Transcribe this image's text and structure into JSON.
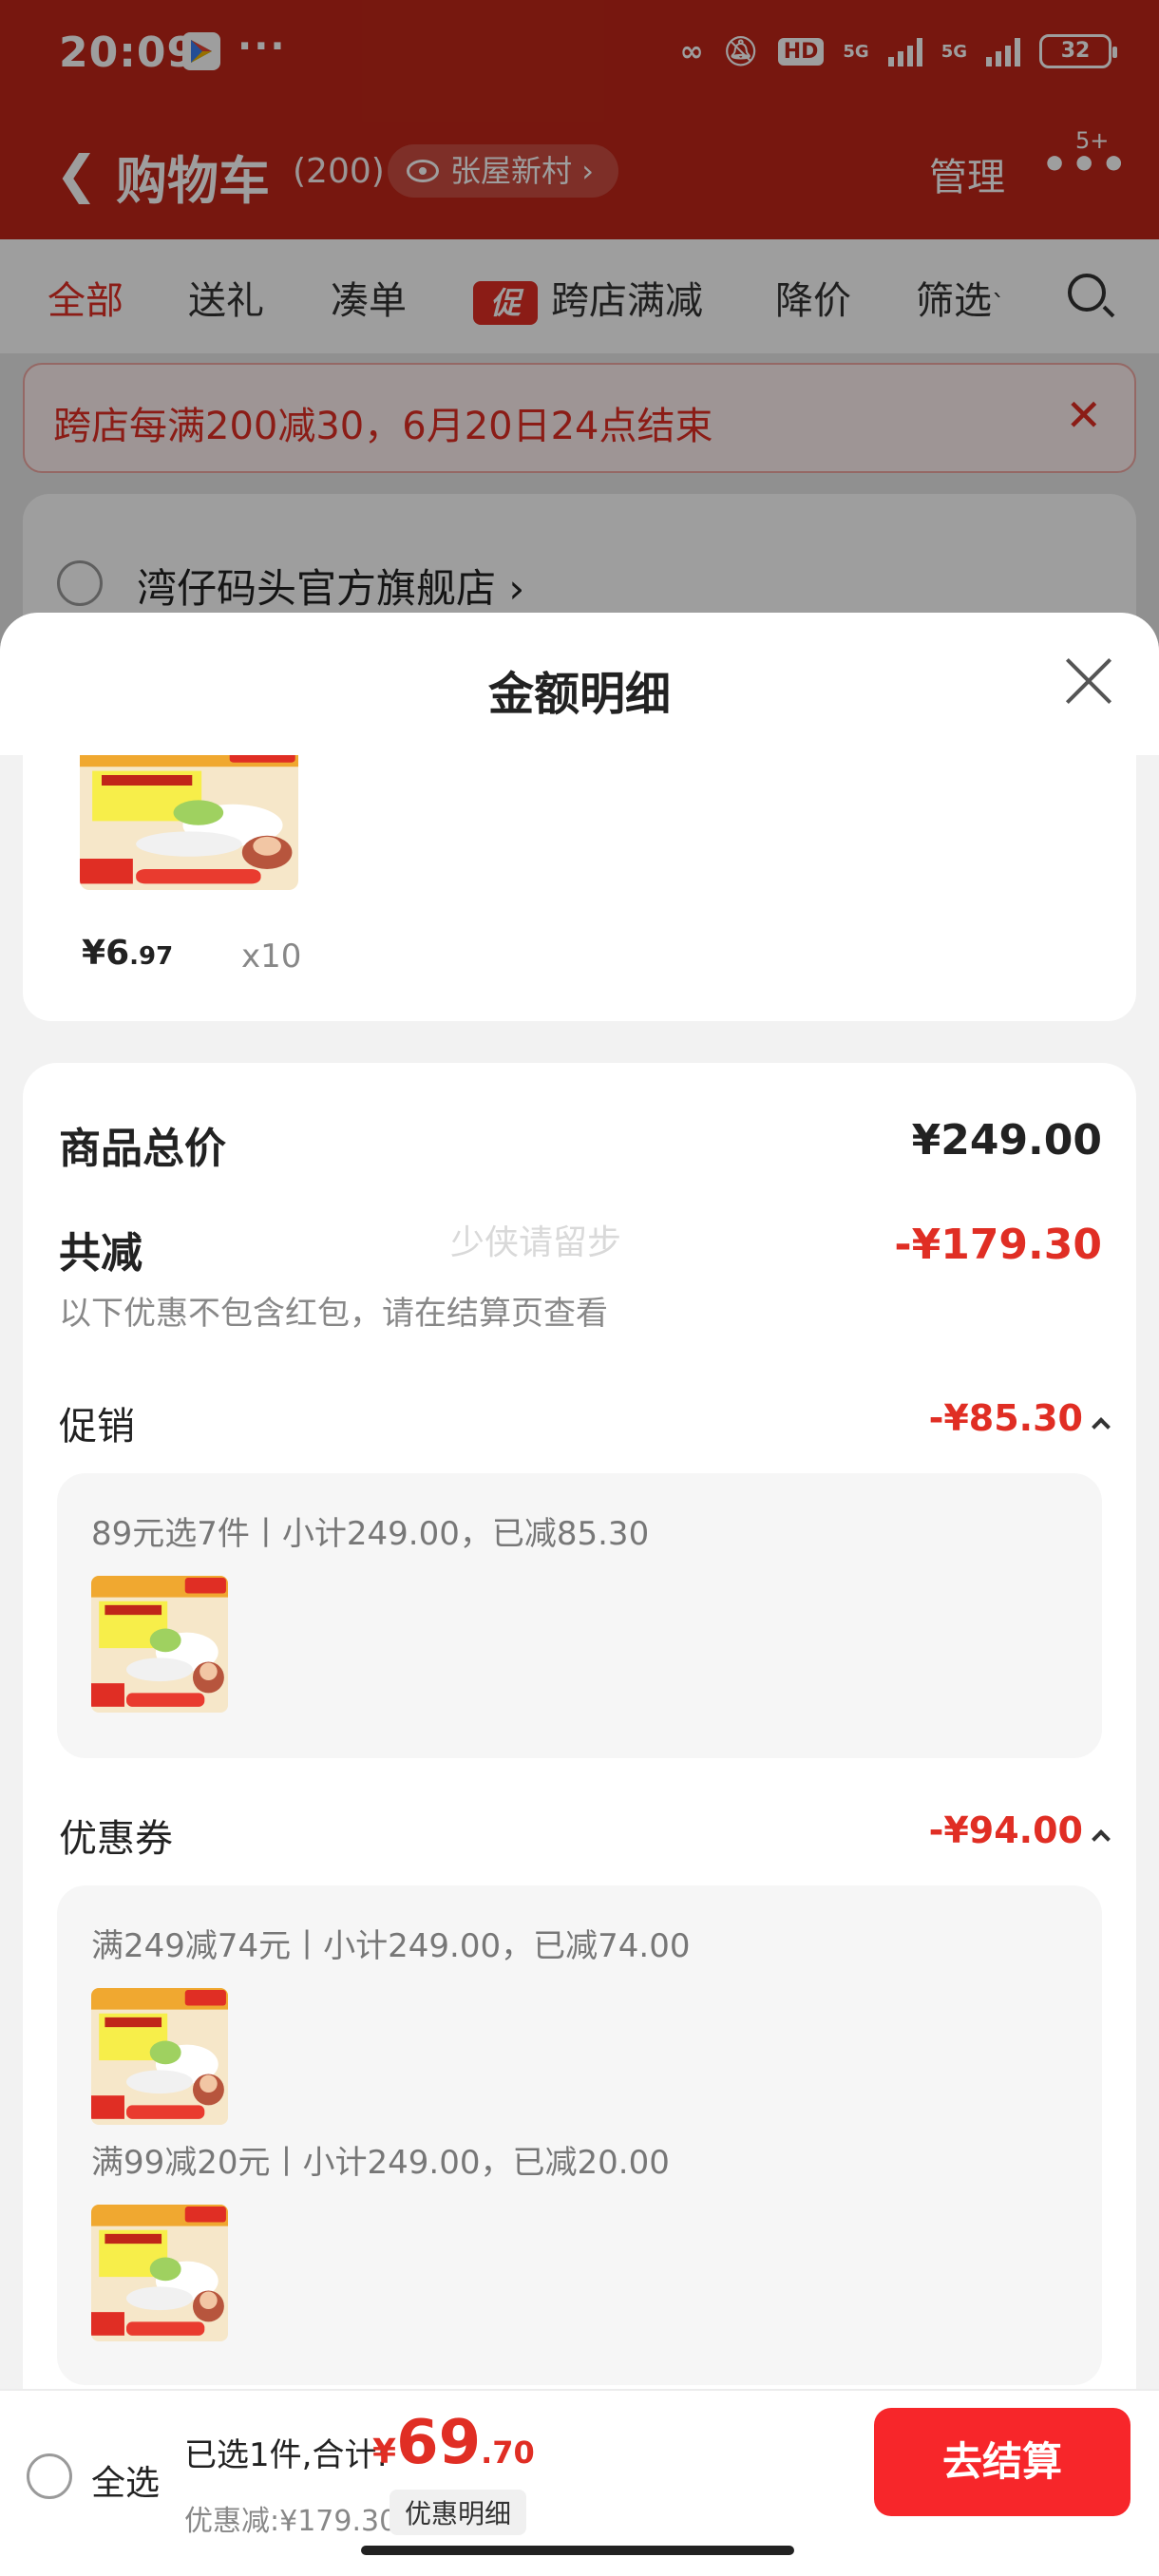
{
  "status_bar": {
    "time": "20:09",
    "more": "···",
    "hd": "HD",
    "net1": "5G",
    "net2": "5G",
    "battery": "32"
  },
  "nav": {
    "title": "购物车",
    "count": "(200)",
    "location": "张屋新村",
    "location_chevron": "›",
    "manage": "管理",
    "menu_dots": "•••",
    "message_badge": "5+"
  },
  "tabs": [
    {
      "label": "全部",
      "active": true
    },
    {
      "label": "送礼"
    },
    {
      "label": "凑单"
    },
    {
      "label": "跨店满减",
      "tag": "促"
    },
    {
      "label": "降价"
    },
    {
      "label": "筛选"
    }
  ],
  "filter_mark": "ˋ",
  "banner": {
    "text": "跨店每满200减30，6月20日24点结束",
    "close": "✕"
  },
  "store": {
    "name": "湾仔码头官方旗舰店",
    "chevron": "›"
  },
  "sheet": {
    "title": "金额明细",
    "item": {
      "price_symbol": "¥",
      "price_int": "6",
      "price_dec": ".97",
      "quantity": "x10"
    },
    "goods_total_label": "商品总价",
    "goods_total_value": "¥249.00",
    "total_discount_label": "共减",
    "total_discount_value": "-¥179.30",
    "discount_note": "以下优惠不包含红包，请在结算页查看",
    "watermark": "少侠请留步",
    "promotion": {
      "label": "促销",
      "value": "-¥85.30",
      "lines": [
        "89元选7件丨小计249.00，已减85.30"
      ]
    },
    "coupon": {
      "label": "优惠券",
      "value": "-¥94.00",
      "lines": [
        "满249减74元丨小计249.00，已减74.00",
        "满99减20元丨小计249.00，已减20.00"
      ]
    }
  },
  "product_image": {
    "brand": "湾仔码头",
    "headline": "玉米蔬菜猪肉水饺",
    "badge_price": "9.9",
    "strip_text": "领券69元任选7",
    "corner_tag": "新品·限时"
  },
  "checkout": {
    "select_all": "全选",
    "selected_summary": "已选1件,合计:",
    "price_symbol": "¥",
    "price_int": "69",
    "price_dec": ".70",
    "discount_text": "优惠减:¥179.30",
    "detail_button": "优惠明细",
    "checkout_button": "去结算"
  },
  "colors": {
    "brand_red": "#e02e24",
    "header_red": "#c02619",
    "checkout_red": "#f7262a"
  }
}
